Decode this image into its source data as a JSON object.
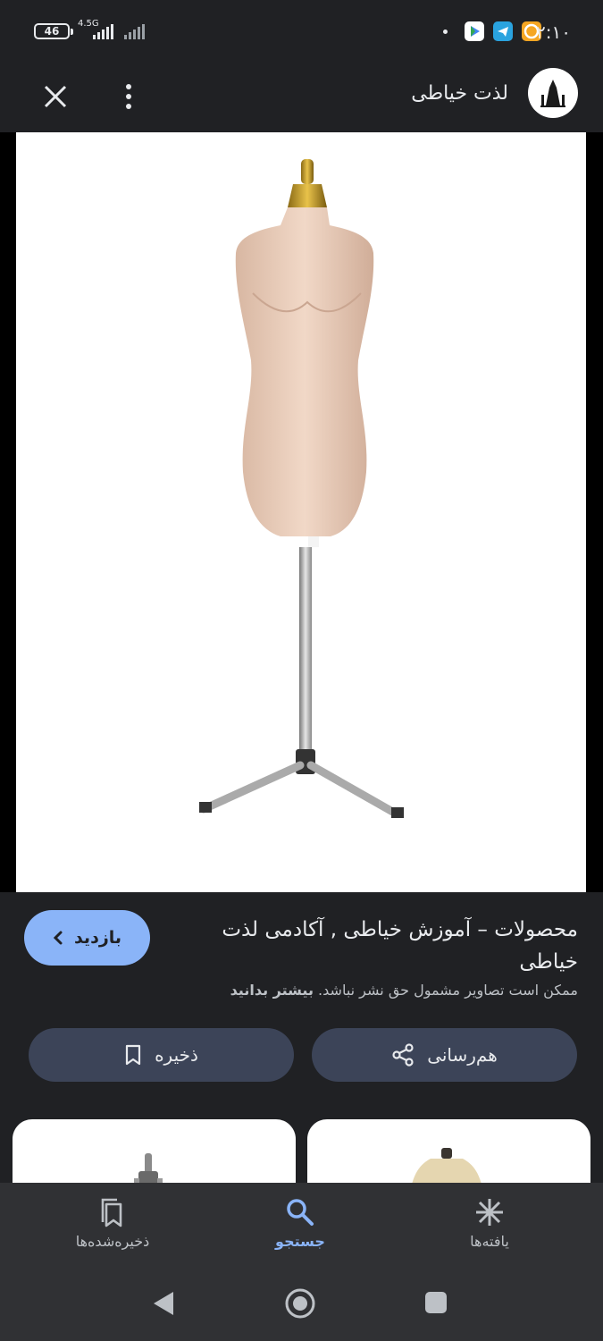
{
  "status_bar": {
    "time": "۲:۱۰",
    "battery": "46",
    "network": "4.5G"
  },
  "header": {
    "site_name": "لذت خیاطی"
  },
  "result": {
    "title": "محصولات – آموزش خیاطی , آکادمی لذت خیاطی",
    "copyright_notice": "ممکن است تصاویر مشمول حق نشر نباشد.",
    "learn_more": "بیشتر بدانید",
    "visit_label": "بازدید",
    "share_label": "هم‌رسانی",
    "save_label": "ذخیره"
  },
  "bottom_nav": {
    "items": [
      {
        "label": "ذخیره‌شده‌ها",
        "icon": "bookmarks-icon",
        "active": false
      },
      {
        "label": "جستجو",
        "icon": "search-icon",
        "active": true
      },
      {
        "label": "یافته‌ها",
        "icon": "asterisk-icon",
        "active": false
      }
    ]
  },
  "colors": {
    "background": "#202124",
    "accent": "#8ab4f8",
    "action_button": "#3c4458",
    "nav_bar": "#303134"
  }
}
